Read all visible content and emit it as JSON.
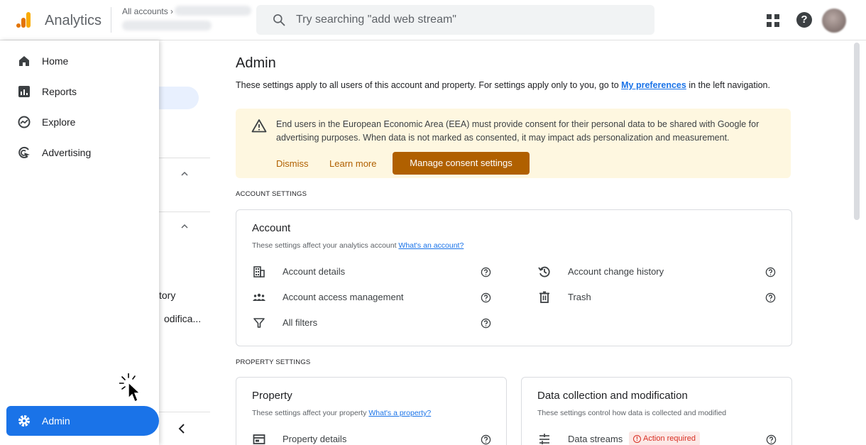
{
  "header": {
    "app_name": "Analytics",
    "breadcrumb_root": "All accounts",
    "search_placeholder": "Try searching \"add web stream\""
  },
  "nav": {
    "items": [
      {
        "label": "Home",
        "icon": "home-icon"
      },
      {
        "label": "Reports",
        "icon": "reports-icon"
      },
      {
        "label": "Explore",
        "icon": "explore-icon"
      },
      {
        "label": "Advertising",
        "icon": "advertising-icon"
      }
    ],
    "admin_label": "Admin"
  },
  "sub_panel": {
    "text_1": "tory",
    "text_2": "odifica..."
  },
  "main": {
    "title": "Admin",
    "desc_before": "These settings apply to all users of this account and property. For settings apply only to you, go to ",
    "desc_link": "My preferences",
    "desc_after": " in the left navigation."
  },
  "banner": {
    "text": "End users in the European Economic Area (EEA) must provide consent for their personal data to be shared with Google for advertising purposes. When data is not marked as consented, it may impact ads personalization and measurement.",
    "dismiss": "Dismiss",
    "learn_more": "Learn more",
    "manage": "Manage consent settings"
  },
  "account_settings": {
    "section_label": "ACCOUNT SETTINGS",
    "title": "Account",
    "subtitle": "These settings affect your analytics account ",
    "subtitle_link": "What's an account?",
    "rows": [
      {
        "label": "Account details",
        "icon": "building-icon"
      },
      {
        "label": "Account access management",
        "icon": "users-icon"
      },
      {
        "label": "All filters",
        "icon": "filter-icon"
      },
      {
        "label": "Account change history",
        "icon": "history-icon"
      },
      {
        "label": "Trash",
        "icon": "trash-icon"
      }
    ]
  },
  "property_settings": {
    "section_label": "PROPERTY SETTINGS",
    "property": {
      "title": "Property",
      "subtitle": "These settings affect your property ",
      "subtitle_link": "What's a property?",
      "row_label": "Property details"
    },
    "data_collection": {
      "title": "Data collection and modification",
      "subtitle": "These settings control how data is collected and modified",
      "row_label": "Data streams",
      "badge": "Action required"
    }
  }
}
